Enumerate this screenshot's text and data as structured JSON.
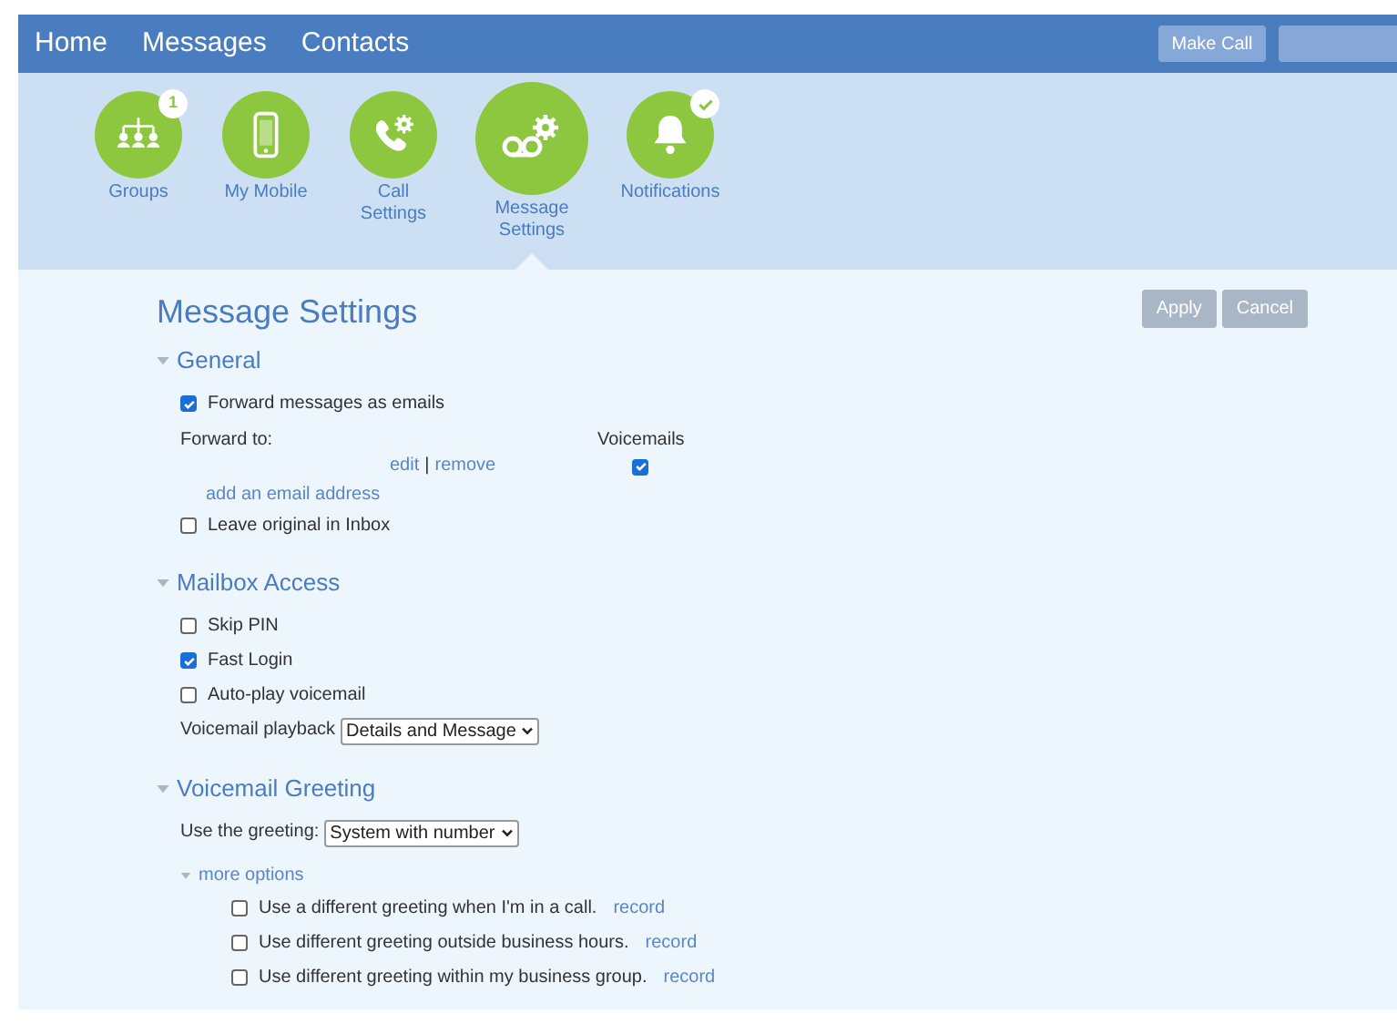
{
  "nav": {
    "items": [
      {
        "label": "Home"
      },
      {
        "label": "Messages"
      },
      {
        "label": "Contacts"
      }
    ],
    "make_call": "Make Call"
  },
  "feature_tabs": [
    {
      "label": "Groups",
      "selected": false,
      "badge": {
        "kind": "count",
        "text": "1"
      }
    },
    {
      "label": "My Mobile",
      "selected": false
    },
    {
      "label": "Call Settings",
      "selected": false
    },
    {
      "label": "Message Settings",
      "selected": true
    },
    {
      "label": "Notifications",
      "selected": false,
      "badge": {
        "kind": "check"
      }
    }
  ],
  "title": "Message Settings",
  "buttons": [
    {
      "label": "Apply",
      "disabled": true
    },
    {
      "label": "Cancel",
      "disabled": true
    }
  ],
  "sections": [
    {
      "title": "General",
      "expanded": true,
      "items": [
        {
          "kind": "checkbox",
          "label": "Forward messages as emails",
          "checked": true
        },
        {
          "kind": "forward_table",
          "label": "Forward to:",
          "column": "Voicemails",
          "rows": [
            {
              "edit": "edit",
              "separator": "|",
              "remove": "remove",
              "checked": true
            }
          ],
          "add_link": "add an email address"
        },
        {
          "kind": "checkbox",
          "label": "Leave original in Inbox",
          "checked": false
        }
      ]
    },
    {
      "title": "Mailbox Access",
      "expanded": true,
      "items": [
        {
          "kind": "checkbox",
          "label": "Skip PIN",
          "checked": false
        },
        {
          "kind": "checkbox",
          "label": "Fast Login",
          "checked": true
        },
        {
          "kind": "checkbox",
          "label": "Auto-play voicemail",
          "checked": false
        },
        {
          "kind": "select",
          "label": "Voicemail playback",
          "value": "Details and Message"
        }
      ]
    },
    {
      "title": "Voicemail Greeting",
      "expanded": true,
      "items": [
        {
          "kind": "select",
          "label": "Use the greeting:",
          "value": "System with number"
        },
        {
          "kind": "more",
          "label": "more options",
          "expanded": true,
          "children": [
            {
              "label": "Use a different greeting when I'm in a call.",
              "link": "record",
              "checked": false
            },
            {
              "label": "Use different greeting outside business hours.",
              "link": "record",
              "checked": false
            },
            {
              "label": "Use different greeting within my business group.",
              "link": "record",
              "checked": false
            }
          ]
        }
      ]
    }
  ]
}
